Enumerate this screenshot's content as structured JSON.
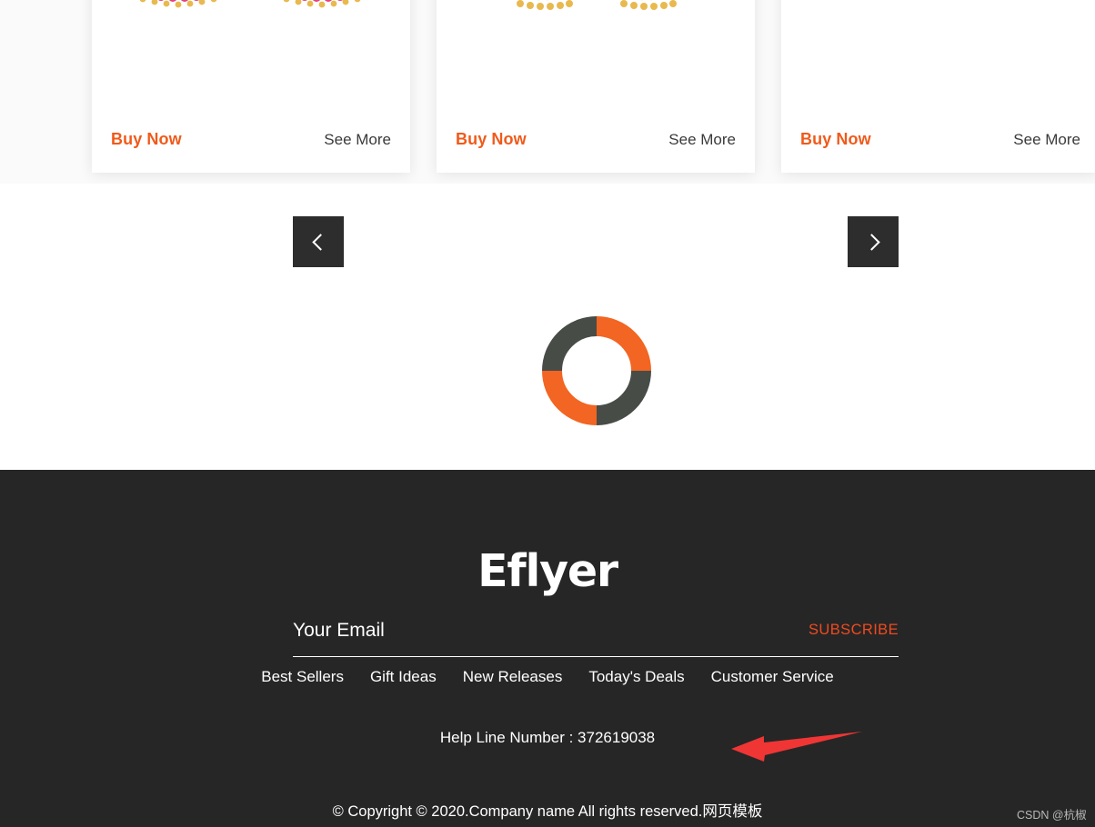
{
  "page": {
    "background_color": "#ffffff",
    "section_background": "#fafafa",
    "accent_orange": "#f05a1a",
    "footer_background": "#262626",
    "dark_button": "#2d2d2d",
    "annotation_red": "#f03535"
  },
  "products": {
    "cards": [
      {
        "buy_label": "Buy Now",
        "see_more_label": "See More",
        "image_kind": "pink-gold-beaded-bangles"
      },
      {
        "buy_label": "Buy Now",
        "see_more_label": "See More",
        "image_kind": "gold-jhumka-earrings"
      },
      {
        "buy_label": "Buy Now",
        "see_more_label": "See More",
        "image_kind": "none"
      }
    ]
  },
  "carousel": {
    "prev_icon": "chevron-left-icon",
    "next_icon": "chevron-right-icon",
    "prev_label": "Previous",
    "next_label": "Next"
  },
  "loader": {
    "icon": "loading-spinner-icon",
    "segment_dark": "#474c47",
    "segment_orange": "#f26522"
  },
  "footer": {
    "logo": "Eflyer",
    "subscribe": {
      "placeholder": "Your Email",
      "value": "",
      "button_label": "SUBSCRIBE"
    },
    "nav_links": [
      {
        "label": "Best Sellers"
      },
      {
        "label": "Gift Ideas"
      },
      {
        "label": "New Releases"
      },
      {
        "label": "Today's Deals"
      },
      {
        "label": "Customer Service"
      }
    ],
    "helpline": "Help Line Number : 372619038",
    "helpline_arrow_icon": "red-arrow-left-annotation",
    "copyright": "© Copyright © 2020.Company name All rights reserved.网页模板"
  },
  "watermark": {
    "text": "CSDN @杭椒"
  }
}
